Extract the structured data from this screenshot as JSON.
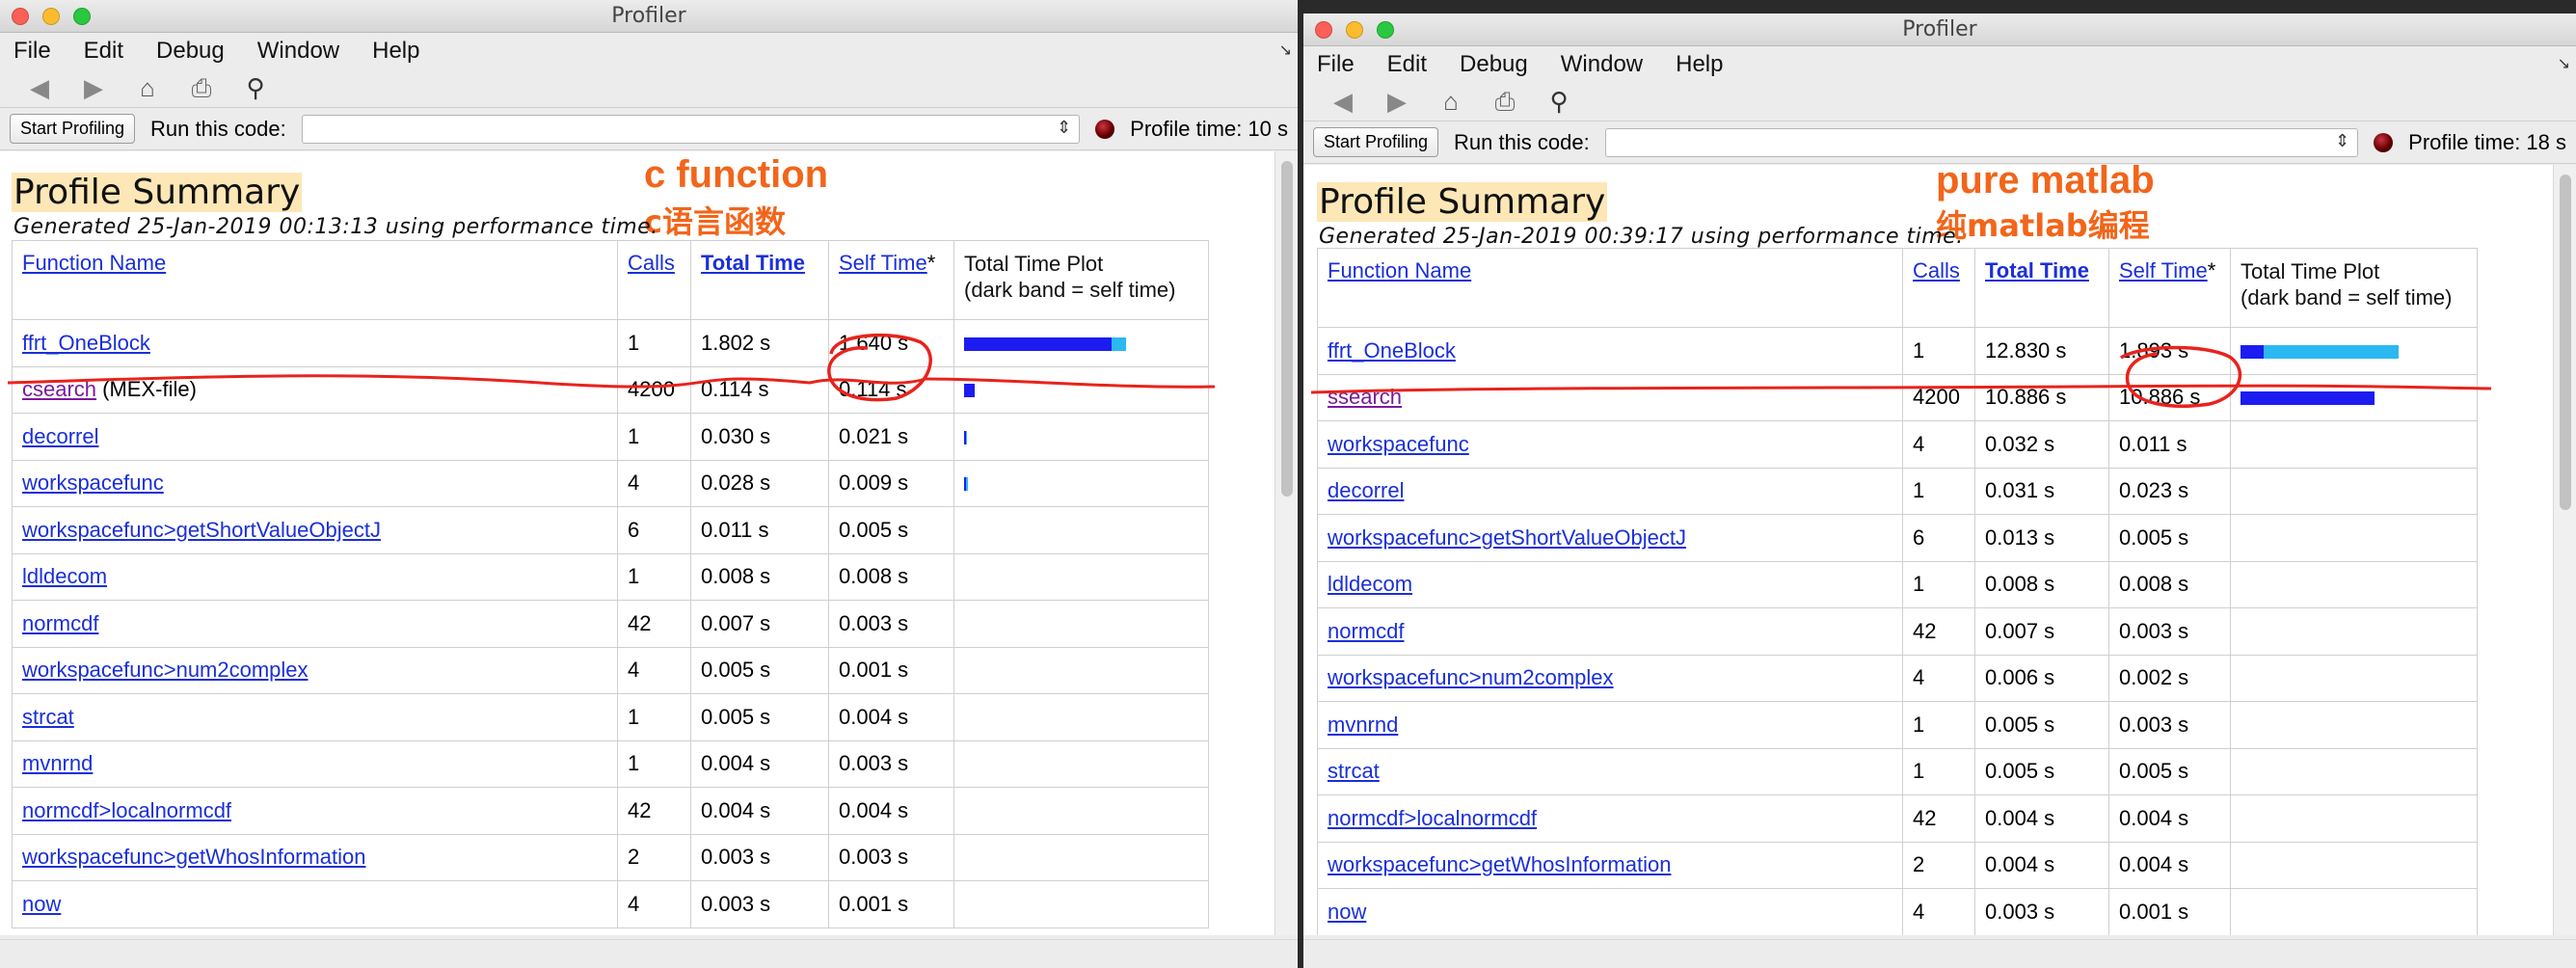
{
  "left": {
    "window_title": "Profiler",
    "menu": [
      "File",
      "Edit",
      "Debug",
      "Window",
      "Help"
    ],
    "start_profiling": "Start Profiling",
    "run_label": "Run this code:",
    "run_value": "",
    "profile_time": "Profile time: 10 s",
    "summary_title": "Profile Summary",
    "generated": "Generated 25-Jan-2019 00:13:13 using performance time.",
    "annotation_en": "c function",
    "annotation_zh": "c语言函数",
    "headers": {
      "function_name": "Function Name",
      "calls": "Calls",
      "total_time": "Total Time",
      "self_time": "Self Time",
      "self_time_mark": "*",
      "plot_line1": "Total Time Plot",
      "plot_line2": "(dark band = self time)"
    },
    "rows": [
      {
        "name": "ffrt_OneBlock",
        "suffix": "",
        "calls": "1",
        "total": "1.802 s",
        "self": "1.640 s",
        "total_frac": 1.0,
        "self_frac": 0.91
      },
      {
        "name": "csearch",
        "suffix": " (MEX-file)",
        "calls": "4200",
        "total": "0.114 s",
        "self": "0.114 s",
        "total_frac": 0.063,
        "self_frac": 0.063
      },
      {
        "name": "decorrel",
        "suffix": "",
        "calls": "1",
        "total": "0.030 s",
        "self": "0.021 s",
        "total_frac": 0.017,
        "self_frac": 0.012
      },
      {
        "name": "workspacefunc",
        "suffix": "",
        "calls": "4",
        "total": "0.028 s",
        "self": "0.009 s",
        "total_frac": 0.016,
        "self_frac": 0.005
      },
      {
        "name": "workspacefunc>getShortValueObjectJ",
        "suffix": "",
        "calls": "6",
        "total": "0.011 s",
        "self": "0.005 s",
        "total_frac": 0,
        "self_frac": 0
      },
      {
        "name": "ldldecom",
        "suffix": "",
        "calls": "1",
        "total": "0.008 s",
        "self": "0.008 s",
        "total_frac": 0,
        "self_frac": 0
      },
      {
        "name": "normcdf",
        "suffix": "",
        "calls": "42",
        "total": "0.007 s",
        "self": "0.003 s",
        "total_frac": 0,
        "self_frac": 0
      },
      {
        "name": "workspacefunc>num2complex",
        "suffix": "",
        "calls": "4",
        "total": "0.005 s",
        "self": "0.001 s",
        "total_frac": 0,
        "self_frac": 0
      },
      {
        "name": "strcat",
        "suffix": "",
        "calls": "1",
        "total": "0.005 s",
        "self": "0.004 s",
        "total_frac": 0,
        "self_frac": 0
      },
      {
        "name": "mvnrnd",
        "suffix": "",
        "calls": "1",
        "total": "0.004 s",
        "self": "0.003 s",
        "total_frac": 0,
        "self_frac": 0
      },
      {
        "name": "normcdf>localnormcdf",
        "suffix": "",
        "calls": "42",
        "total": "0.004 s",
        "self": "0.004 s",
        "total_frac": 0,
        "self_frac": 0
      },
      {
        "name": "workspacefunc>getWhosInformation",
        "suffix": "",
        "calls": "2",
        "total": "0.003 s",
        "self": "0.003 s",
        "total_frac": 0,
        "self_frac": 0
      },
      {
        "name": "now",
        "suffix": "",
        "calls": "4",
        "total": "0.003 s",
        "self": "0.001 s",
        "total_frac": 0,
        "self_frac": 0
      }
    ]
  },
  "right": {
    "window_title": "Profiler",
    "menu": [
      "File",
      "Edit",
      "Debug",
      "Window",
      "Help"
    ],
    "start_profiling": "Start Profiling",
    "run_label": "Run this code:",
    "run_value": "",
    "profile_time": "Profile time: 18 s",
    "summary_title": "Profile Summary",
    "generated": "Generated 25-Jan-2019 00:39:17 using performance time.",
    "annotation_en": "pure matlab",
    "annotation_zh": "纯matlab编程",
    "headers": {
      "function_name": "Function Name",
      "calls": "Calls",
      "total_time": "Total Time",
      "self_time": "Self Time",
      "self_time_mark": "*",
      "plot_line1": "Total Time Plot",
      "plot_line2": "(dark band = self time)"
    },
    "rows": [
      {
        "name": "ffrt_OneBlock",
        "suffix": "",
        "calls": "1",
        "total": "12.830 s",
        "self": "1.893 s",
        "total_frac": 1.0,
        "self_frac": 0.148
      },
      {
        "name": "ssearch",
        "suffix": "",
        "calls": "4200",
        "total": "10.886 s",
        "self": "10.886 s",
        "total_frac": 0.848,
        "self_frac": 0.848
      },
      {
        "name": "workspacefunc",
        "suffix": "",
        "calls": "4",
        "total": "0.032 s",
        "self": "0.011 s",
        "total_frac": 0,
        "self_frac": 0
      },
      {
        "name": "decorrel",
        "suffix": "",
        "calls": "1",
        "total": "0.031 s",
        "self": "0.023 s",
        "total_frac": 0,
        "self_frac": 0
      },
      {
        "name": "workspacefunc>getShortValueObjectJ",
        "suffix": "",
        "calls": "6",
        "total": "0.013 s",
        "self": "0.005 s",
        "total_frac": 0,
        "self_frac": 0
      },
      {
        "name": "ldldecom",
        "suffix": "",
        "calls": "1",
        "total": "0.008 s",
        "self": "0.008 s",
        "total_frac": 0,
        "self_frac": 0
      },
      {
        "name": "normcdf",
        "suffix": "",
        "calls": "42",
        "total": "0.007 s",
        "self": "0.003 s",
        "total_frac": 0,
        "self_frac": 0
      },
      {
        "name": "workspacefunc>num2complex",
        "suffix": "",
        "calls": "4",
        "total": "0.006 s",
        "self": "0.002 s",
        "total_frac": 0,
        "self_frac": 0
      },
      {
        "name": "mvnrnd",
        "suffix": "",
        "calls": "1",
        "total": "0.005 s",
        "self": "0.003 s",
        "total_frac": 0,
        "self_frac": 0
      },
      {
        "name": "strcat",
        "suffix": "",
        "calls": "1",
        "total": "0.005 s",
        "self": "0.005 s",
        "total_frac": 0,
        "self_frac": 0
      },
      {
        "name": "normcdf>localnormcdf",
        "suffix": "",
        "calls": "42",
        "total": "0.004 s",
        "self": "0.004 s",
        "total_frac": 0,
        "self_frac": 0
      },
      {
        "name": "workspacefunc>getWhosInformation",
        "suffix": "",
        "calls": "2",
        "total": "0.004 s",
        "self": "0.004 s",
        "total_frac": 0,
        "self_frac": 0
      },
      {
        "name": "now",
        "suffix": "",
        "calls": "4",
        "total": "0.003 s",
        "self": "0.001 s",
        "total_frac": 0,
        "self_frac": 0
      }
    ]
  },
  "colors": {
    "self_band": "#1c1cf0",
    "total_band": "#2bb8f0",
    "link": "#1a2fd9",
    "visited_link": "#7a1a9a",
    "annotation": "#f2651a",
    "ink": "#e8231c"
  },
  "icons": [
    "back-arrow-icon",
    "forward-arrow-icon",
    "home-icon",
    "print-icon",
    "find-binoculars-icon"
  ]
}
